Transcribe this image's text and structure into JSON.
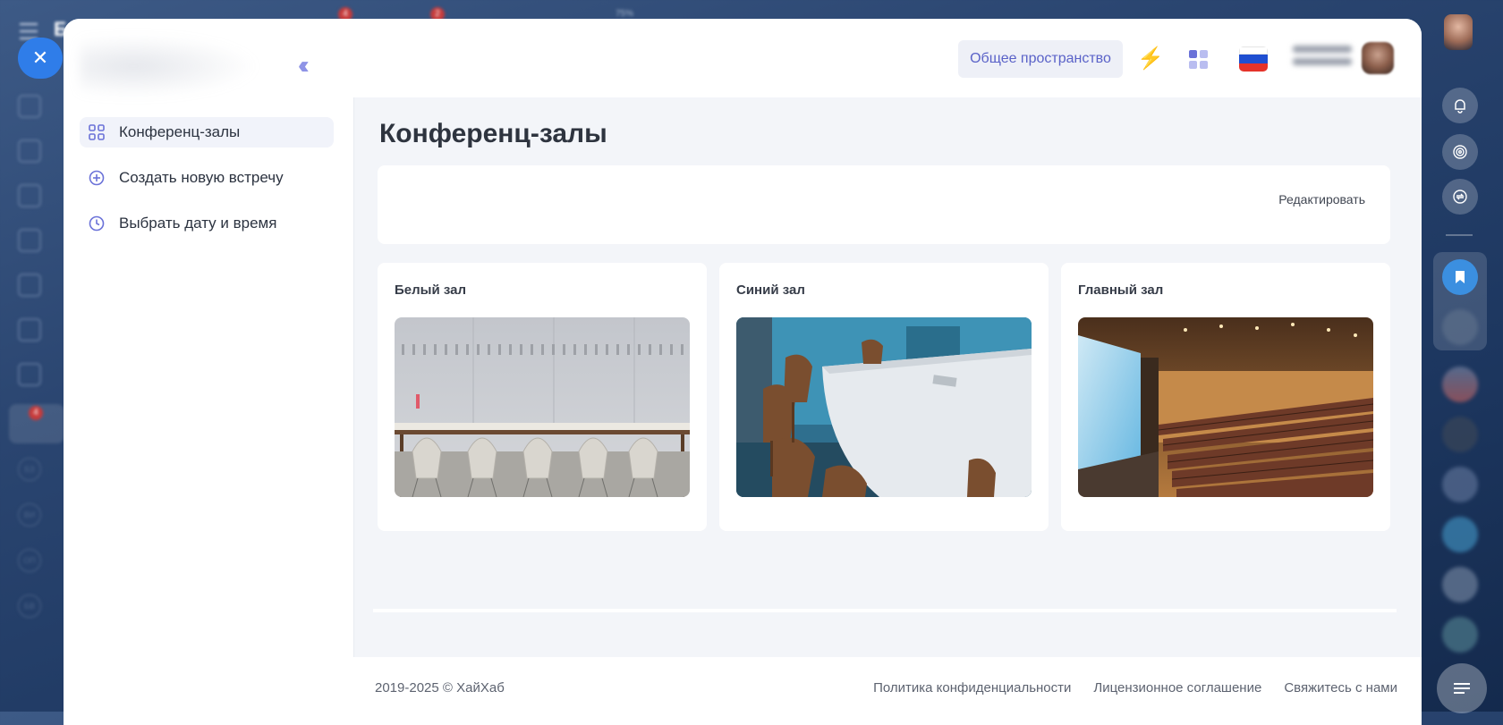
{
  "background_app": {
    "badges": [
      "4",
      "2",
      "4"
    ],
    "zoom": "75%",
    "sidebar_initials": [
      "БЗ",
      "ВИ",
      "ОП",
      "БВ"
    ]
  },
  "sidebar": {
    "items": [
      {
        "label": "Конференц-залы",
        "icon": "grid-icon",
        "active": true
      },
      {
        "label": "Создать новую встречу",
        "icon": "plus-circle-icon",
        "active": false
      },
      {
        "label": "Выбрать дату и время",
        "icon": "clock-icon",
        "active": false
      }
    ]
  },
  "header": {
    "workspace_label": "Общее пространство",
    "icons": [
      "bolt-icon",
      "apps-icon",
      "flag-ru-icon"
    ],
    "accent": "#5a62c8"
  },
  "main": {
    "title": "Конференц-залы",
    "edit_label": "Редактировать",
    "rooms": [
      {
        "name": "Белый зал"
      },
      {
        "name": "Синий зал"
      },
      {
        "name": "Главный зал"
      }
    ]
  },
  "footer": {
    "copyright": "2019-2025 © ХайХаб",
    "links": [
      "Политика конфиденциальности",
      "Лицензионное соглашение",
      "Свяжитесь с нами"
    ]
  },
  "dock": {
    "icons": [
      "bell-icon",
      "spiral-icon",
      "sync-icon",
      "bookmark-icon",
      "menu-icon"
    ],
    "bookmark_color": "#3b8fe0"
  }
}
